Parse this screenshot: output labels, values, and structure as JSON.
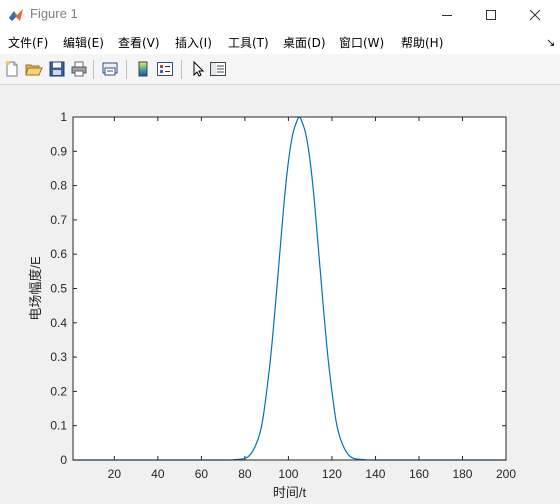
{
  "window": {
    "title": "Figure 1",
    "icon": "matlab-icon"
  },
  "menu": {
    "items": [
      "文件(F)",
      "编辑(E)",
      "查看(V)",
      "插入(I)",
      "工具(T)",
      "桌面(D)",
      "窗口(W)",
      "帮助(H)"
    ],
    "overflow": "↘"
  },
  "toolbar": {
    "icons": [
      "new-figure-icon",
      "open-file-icon",
      "save-icon",
      "print-icon",
      "link-plot-icon",
      "insert-colorbar-icon",
      "insert-legend-icon",
      "edit-plot-icon",
      "property-editor-icon"
    ]
  },
  "colors": {
    "line": "#0072BD",
    "axes_bg": "#ffffff",
    "figure_bg": "#f0f0f0"
  },
  "chart_data": {
    "type": "line",
    "title": "",
    "xlabel": "时间/t",
    "ylabel": "电场幅度/E",
    "xlim": [
      1,
      200
    ],
    "ylim": [
      0,
      1
    ],
    "xticks": [
      20,
      40,
      60,
      80,
      100,
      120,
      140,
      160,
      180,
      200
    ],
    "yticks": [
      0,
      0.1,
      0.2,
      0.3,
      0.4,
      0.5,
      0.6,
      0.7,
      0.8,
      0.9,
      1
    ],
    "grid": false,
    "series": [
      {
        "x": [
          1,
          70,
          75,
          80,
          83,
          86,
          88,
          90,
          92,
          94,
          96,
          98,
          100,
          102,
          104,
          105,
          106,
          108,
          110,
          112,
          114,
          116,
          118,
          120,
          122,
          124,
          127,
          130,
          135,
          140,
          200
        ],
        "y": [
          0,
          0.0,
          0.001,
          0.005,
          0.02,
          0.06,
          0.11,
          0.2,
          0.31,
          0.45,
          0.6,
          0.75,
          0.87,
          0.95,
          0.99,
          1.0,
          0.99,
          0.95,
          0.87,
          0.75,
          0.6,
          0.45,
          0.31,
          0.2,
          0.11,
          0.06,
          0.02,
          0.005,
          0.001,
          0.0,
          0
        ]
      }
    ]
  }
}
